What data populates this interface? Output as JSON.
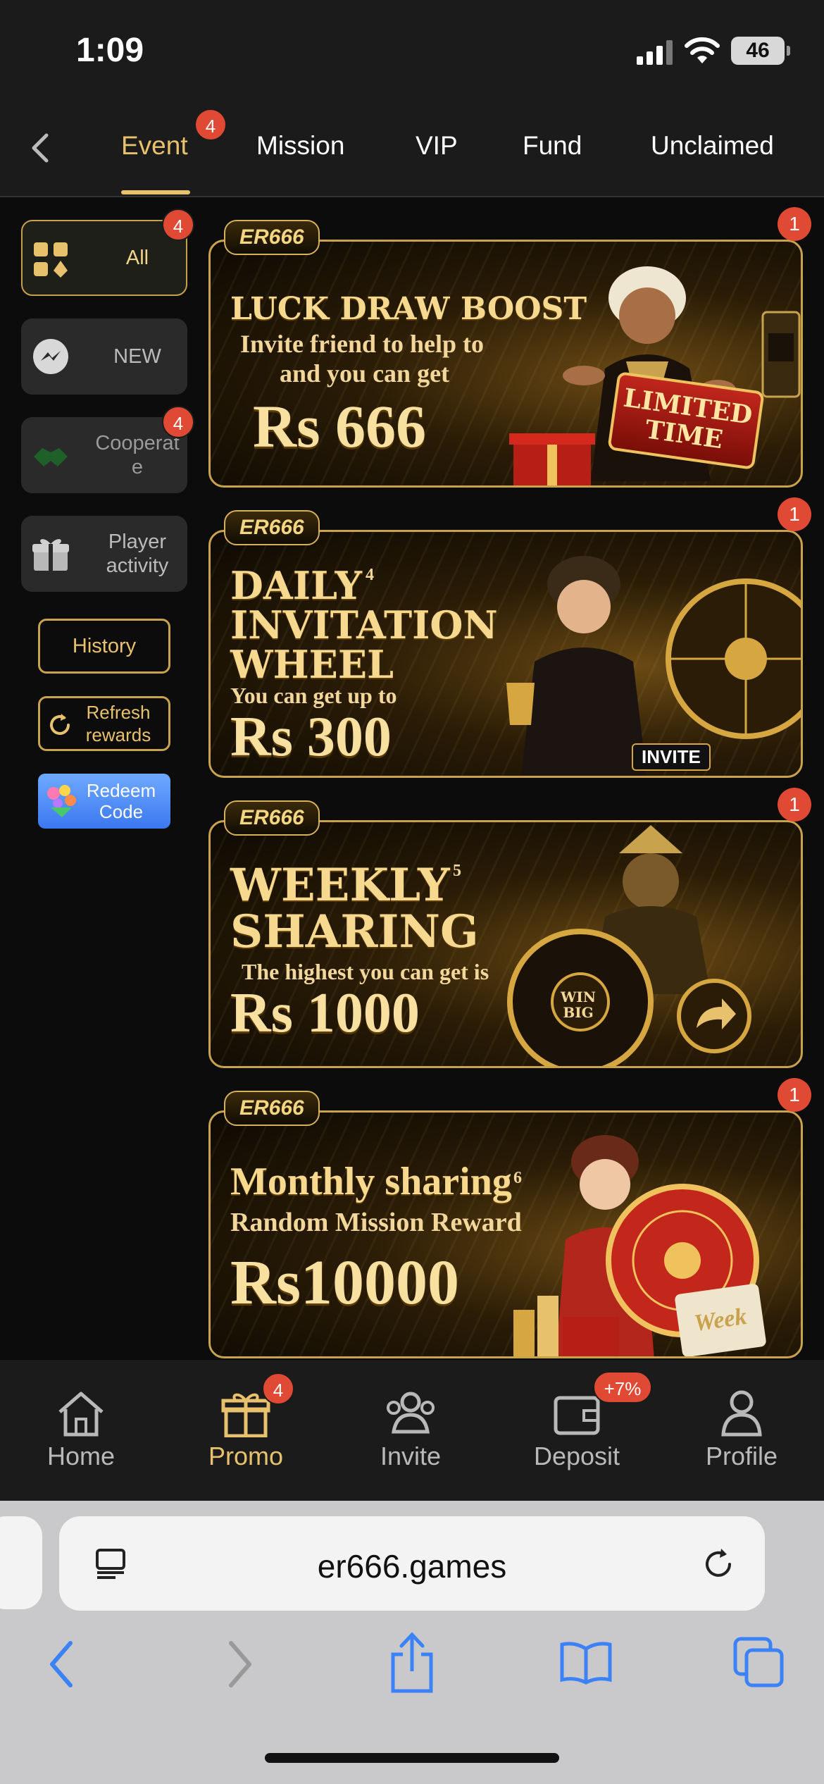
{
  "status": {
    "time": "1:09",
    "battery": "46"
  },
  "top_tabs": [
    {
      "label": "Event",
      "badge": "4"
    },
    {
      "label": "Mission"
    },
    {
      "label": "VIP"
    },
    {
      "label": "Fund"
    },
    {
      "label": "Unclaimed"
    }
  ],
  "sidebar": {
    "items": [
      {
        "label": "All",
        "badge": "4"
      },
      {
        "label": "NEW"
      },
      {
        "label": "Cooperat e",
        "badge": "4"
      },
      {
        "label": "Player activity"
      }
    ],
    "history": "History",
    "refresh": "Refresh rewards",
    "redeem": "Redeem Code"
  },
  "banners": [
    {
      "logo": "ER666",
      "badge": "1",
      "title": "LUCK DRAW BOOST",
      "sub1": "Invite friend to help to",
      "sub2": "and you can get",
      "amount": "Rs 666",
      "tag": "LIMITED TIME"
    },
    {
      "logo": "ER666",
      "badge": "1",
      "title1": "DAILY",
      "num": "4",
      "title2": "INVITATION",
      "title3": "WHEEL",
      "sub": "You can get up to",
      "amount": "Rs 300",
      "tag": "INVITE"
    },
    {
      "logo": "ER666",
      "badge": "1",
      "title1": "WEEKLY",
      "num": "5",
      "title2": "SHARING",
      "sub": "The highest you can get is",
      "amount": "Rs 1000",
      "wheel_label": "WIN BIG"
    },
    {
      "logo": "ER666",
      "badge": "1",
      "title": "Monthly sharing",
      "num": "6",
      "sub": "Random Mission Reward",
      "amount": "Rs10000",
      "tag": "Week"
    }
  ],
  "bottom_nav": [
    {
      "label": "Home",
      "icon": "home-icon"
    },
    {
      "label": "Promo",
      "icon": "gift-icon",
      "badge": "4"
    },
    {
      "label": "Invite",
      "icon": "people-icon"
    },
    {
      "label": "Deposit",
      "icon": "wallet-icon",
      "badge": "+7%"
    },
    {
      "label": "Profile",
      "icon": "person-icon"
    }
  ],
  "browser": {
    "url": "er666.games"
  },
  "colors": {
    "accent_gold": "#e8c16c",
    "badge_red": "#e04a34",
    "link_blue": "#3b82f6"
  }
}
